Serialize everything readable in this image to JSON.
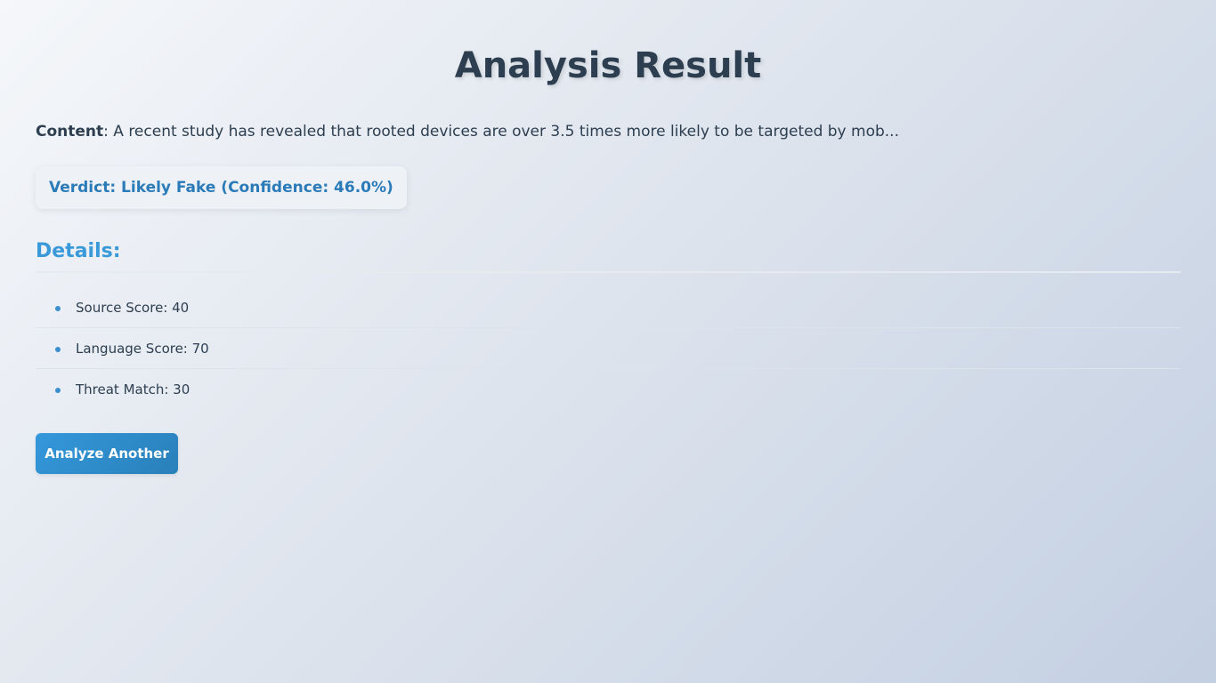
{
  "page": {
    "title": "Analysis Result"
  },
  "content": {
    "label": "Content",
    "text": ": A recent study has revealed that rooted devices are over 3.5 times more likely to be targeted by mob..."
  },
  "verdict": {
    "text": "Verdict: Likely Fake (Confidence: 46.0%)"
  },
  "details": {
    "heading": "Details:",
    "items": [
      {
        "text": "Source Score: 40"
      },
      {
        "text": "Language Score: 70"
      },
      {
        "text": "Threat Match: 30"
      }
    ]
  },
  "actions": {
    "analyze_another_label": "Analyze Another"
  },
  "colors": {
    "accent": "#3498db",
    "verdict_text": "#2b7bb9",
    "heading_text": "#2c3e50"
  }
}
